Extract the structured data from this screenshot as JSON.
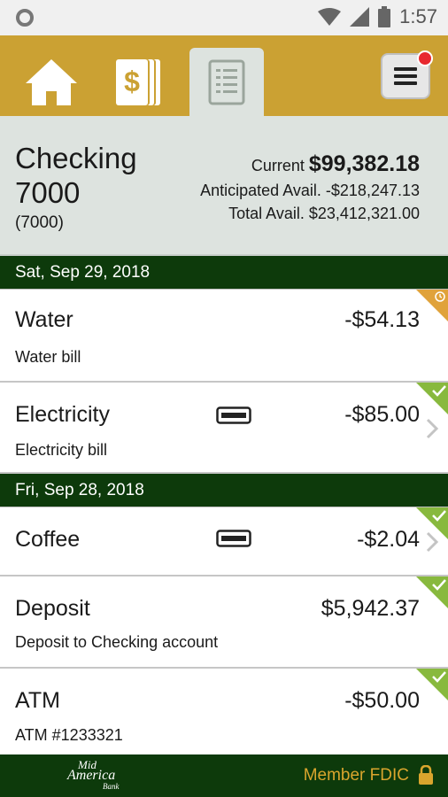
{
  "status_bar": {
    "time": "1:57"
  },
  "nav": {
    "tabs": [
      {
        "name": "home",
        "icon": "home-icon"
      },
      {
        "name": "transfers",
        "icon": "dollar-cards-icon"
      },
      {
        "name": "transactions",
        "icon": "document-icon",
        "active": true
      }
    ],
    "menu_icon": "hamburger-menu-icon",
    "has_notification": true
  },
  "account": {
    "name": "Checking 7000",
    "number": "(7000)",
    "current_label": "Current",
    "current_value": "$99,382.18",
    "anticipated_label": "Anticipated Avail.",
    "anticipated_value": "-$218,247.13",
    "total_label": "Total Avail.",
    "total_value": "$23,412,321.00"
  },
  "days": [
    {
      "date": "Sat, Sep 29, 2018",
      "transactions": [
        {
          "title": "Water",
          "description": "Water bill",
          "amount": "-$54.13",
          "status": "pending"
        },
        {
          "title": "Electricity",
          "description": "Electricity bill",
          "amount": "-$85.00",
          "status": "cleared",
          "card": true,
          "chevron": true
        }
      ]
    },
    {
      "date": "Fri, Sep 28, 2018",
      "transactions": [
        {
          "title": "Coffee",
          "description": "",
          "amount": "-$2.04",
          "status": "cleared",
          "card": true,
          "chevron": true
        },
        {
          "title": "Deposit",
          "description": "Deposit to Checking account",
          "amount": "$5,942.37",
          "status": "cleared"
        },
        {
          "title": "ATM",
          "description": "ATM #1233321",
          "amount": "-$50.00",
          "status": "cleared"
        }
      ]
    }
  ],
  "footer": {
    "logo_text": [
      "Mid",
      "America",
      "Bank"
    ],
    "fdic_label": "Member FDIC"
  },
  "colors": {
    "nav_gold": "#cba133",
    "dark_green": "#0d3a0b",
    "cleared_green": "#88b93e",
    "pending_orange": "#e0a23a",
    "fdic_gold": "#d9a52d"
  }
}
